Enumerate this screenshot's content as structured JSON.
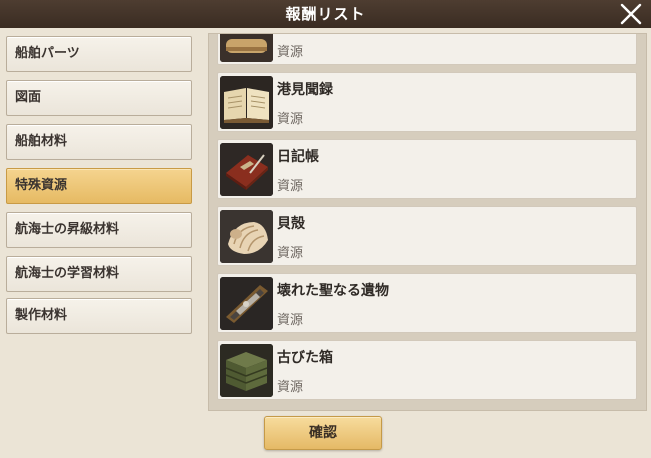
{
  "window": {
    "title": "報酬リスト"
  },
  "categories": [
    {
      "label": "船舶パーツ",
      "active": false
    },
    {
      "label": "図面",
      "active": false
    },
    {
      "label": "船舶材料",
      "active": false
    },
    {
      "label": "特殊資源",
      "active": true
    },
    {
      "label": "航海士の昇級材料",
      "active": false
    },
    {
      "label": "航海士の学習材料",
      "active": false
    },
    {
      "label": "製作材料",
      "active": false
    }
  ],
  "items": [
    {
      "name": "",
      "type": "資源",
      "icon": "scroll-icon"
    },
    {
      "name": "港見聞録",
      "type": "資源",
      "icon": "book-icon"
    },
    {
      "name": "日記帳",
      "type": "資源",
      "icon": "diary-icon"
    },
    {
      "name": "貝殻",
      "type": "資源",
      "icon": "seashell-icon"
    },
    {
      "name": "壊れた聖なる遺物",
      "type": "資源",
      "icon": "relic-icon"
    },
    {
      "name": "古びた箱",
      "type": "資源",
      "icon": "crate-icon"
    }
  ],
  "footer": {
    "confirm_label": "確認"
  },
  "colors": {
    "active_tab": "#e9c270",
    "title_bar": "#43342a",
    "confirm_button": "#efcd84"
  }
}
